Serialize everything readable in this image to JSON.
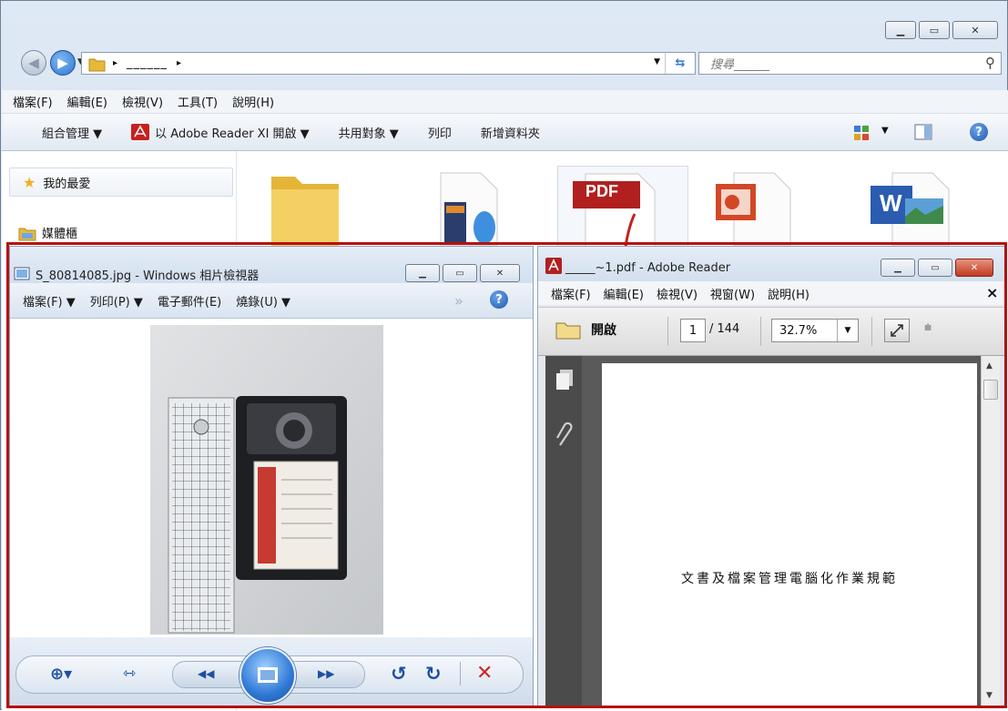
{
  "explorer": {
    "address_path_text": "______",
    "search_placeholder": "搜尋______",
    "menu": [
      "檔案(F)",
      "編輯(E)",
      "檢視(V)",
      "工具(T)",
      "說明(H)"
    ],
    "toolbar": {
      "organize": "組合管理 ▼",
      "open_with": "以 Adobe Reader XI 開啟 ▼",
      "share": "共用對象 ▼",
      "print": "列印",
      "new_folder": "新增資料夾"
    },
    "nav": {
      "favorites": "我的最愛",
      "libraries": "媒體櫃"
    },
    "files": [
      {
        "type": "folder"
      },
      {
        "type": "video"
      },
      {
        "type": "pdf",
        "badge": "PDF"
      },
      {
        "type": "pptx"
      },
      {
        "type": "docx",
        "badge": "W"
      }
    ]
  },
  "photo_viewer": {
    "title": "S_80814085.jpg - Windows 相片檢視器",
    "menu": [
      "檔案(F) ▼",
      "列印(P) ▼",
      "電子郵件(E)",
      "燒錄(U) ▼"
    ],
    "overflow": "»"
  },
  "adobe_reader": {
    "title": "_____~1.pdf - Adobe Reader",
    "menu": [
      "檔案(F)",
      "編輯(E)",
      "檢視(V)",
      "視窗(W)",
      "說明(H)"
    ],
    "close_x": "×",
    "open_label": "開啟",
    "page_current": "1",
    "page_total": "/ 144",
    "zoom": "32.7%",
    "page_text": "文書及檔案管理電腦化作業規範"
  },
  "colors": {
    "selection_frame": "#b80f0f",
    "aero_blue": "#2f79d6",
    "pdf_red": "#b11f1f"
  }
}
